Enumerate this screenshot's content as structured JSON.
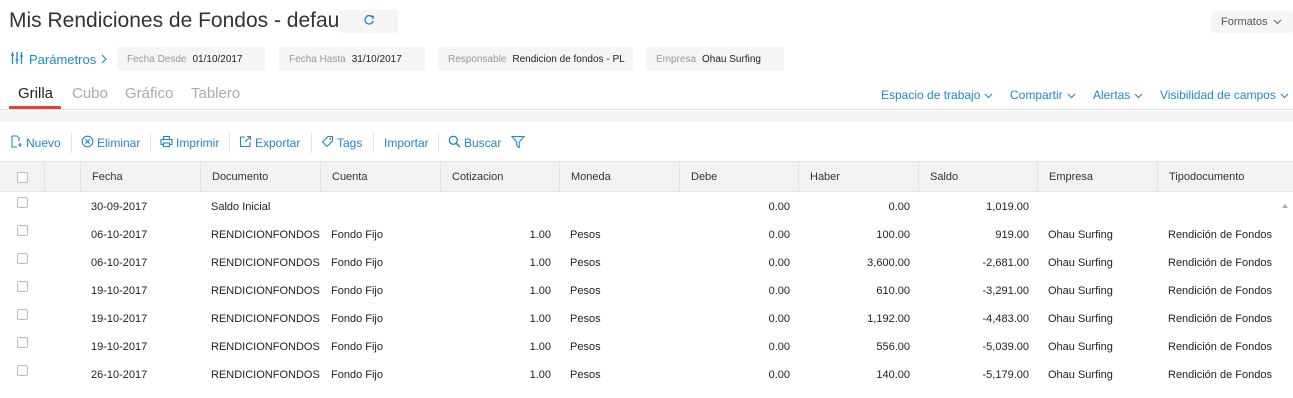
{
  "header": {
    "title": "Mis Rendiciones de Fondos - default",
    "refresh_icon": "refresh-icon",
    "formatos_label": "Formatos"
  },
  "params": {
    "label": "Parámetros",
    "chips": [
      {
        "label": "Fecha Desde",
        "value": "01/10/2017"
      },
      {
        "label": "Fecha Hasta",
        "value": "31/10/2017"
      },
      {
        "label": "Responsable",
        "value": "Rendicion de fondos - PL"
      },
      {
        "label": "Empresa",
        "value": "Ohau Surfing"
      }
    ]
  },
  "tabs": [
    "Grilla",
    "Cubo",
    "Gráfico",
    "Tablero"
  ],
  "active_tab": "Grilla",
  "right_links": [
    "Espacio de trabajo",
    "Compartir",
    "Alertas",
    "Visibilidad de campos"
  ],
  "toolbar": {
    "nuevo": "Nuevo",
    "eliminar": "Eliminar",
    "imprimir": "Imprimir",
    "exportar": "Exportar",
    "tags": "Tags",
    "importar": "Importar",
    "buscar": "Buscar"
  },
  "columns": [
    "Fecha",
    "Documento",
    "Cuenta",
    "Cotizacion",
    "Moneda",
    "Debe",
    "Haber",
    "Saldo",
    "Empresa",
    "Tipodocumento"
  ],
  "rows": [
    {
      "fecha": "30-09-2017",
      "documento": "Saldo Inicial",
      "cuenta": "",
      "cotizacion": "",
      "moneda": "",
      "debe": "0.00",
      "haber": "0.00",
      "saldo": "1,019.00",
      "empresa": "",
      "tipodocumento": ""
    },
    {
      "fecha": "06-10-2017",
      "documento": "RENDICIONFONDOS -",
      "cuenta": "Fondo Fijo",
      "cotizacion": "1.00",
      "moneda": "Pesos",
      "debe": "0.00",
      "haber": "100.00",
      "saldo": "919.00",
      "empresa": "Ohau Surfing",
      "tipodocumento": "Rendición de Fondos"
    },
    {
      "fecha": "06-10-2017",
      "documento": "RENDICIONFONDOS -",
      "cuenta": "Fondo Fijo",
      "cotizacion": "1.00",
      "moneda": "Pesos",
      "debe": "0.00",
      "haber": "3,600.00",
      "saldo": "-2,681.00",
      "empresa": "Ohau Surfing",
      "tipodocumento": "Rendición de Fondos"
    },
    {
      "fecha": "19-10-2017",
      "documento": "RENDICIONFONDOS -",
      "cuenta": "Fondo Fijo",
      "cotizacion": "1.00",
      "moneda": "Pesos",
      "debe": "0.00",
      "haber": "610.00",
      "saldo": "-3,291.00",
      "empresa": "Ohau Surfing",
      "tipodocumento": "Rendición de Fondos"
    },
    {
      "fecha": "19-10-2017",
      "documento": "RENDICIONFONDOS -",
      "cuenta": "Fondo Fijo",
      "cotizacion": "1.00",
      "moneda": "Pesos",
      "debe": "0.00",
      "haber": "1,192.00",
      "saldo": "-4,483.00",
      "empresa": "Ohau Surfing",
      "tipodocumento": "Rendición de Fondos"
    },
    {
      "fecha": "19-10-2017",
      "documento": "RENDICIONFONDOS -",
      "cuenta": "Fondo Fijo",
      "cotizacion": "1.00",
      "moneda": "Pesos",
      "debe": "0.00",
      "haber": "556.00",
      "saldo": "-5,039.00",
      "empresa": "Ohau Surfing",
      "tipodocumento": "Rendición de Fondos"
    },
    {
      "fecha": "26-10-2017",
      "documento": "RENDICIONFONDOS -",
      "cuenta": "Fondo Fijo",
      "cotizacion": "1.00",
      "moneda": "Pesos",
      "debe": "0.00",
      "haber": "140.00",
      "saldo": "-5,179.00",
      "empresa": "Ohau Surfing",
      "tipodocumento": "Rendición de Fondos"
    }
  ],
  "colors": {
    "accent": "#1e88c9",
    "active_tab_underline": "#e2462c"
  }
}
